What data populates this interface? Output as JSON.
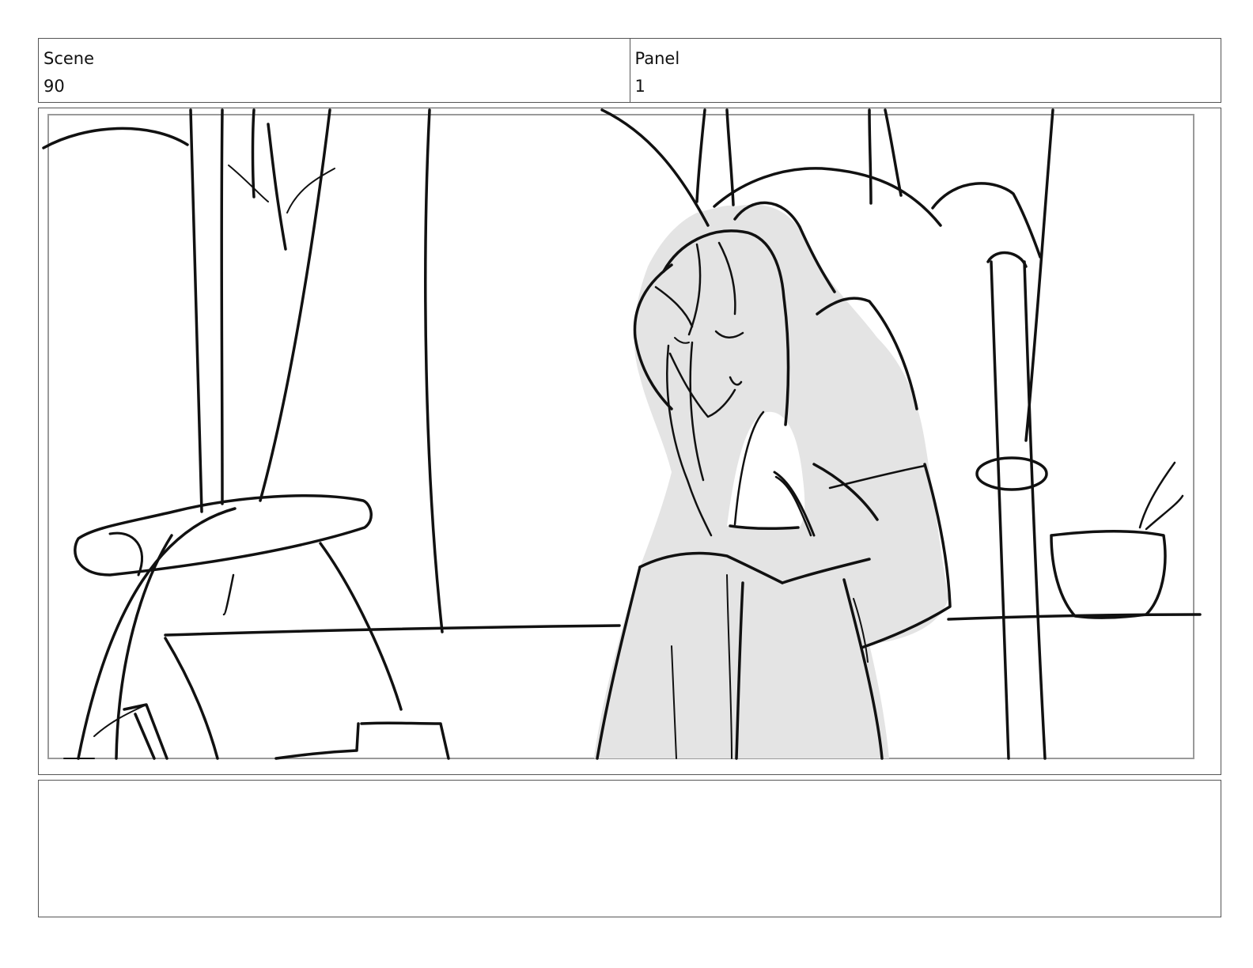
{
  "header": {
    "scene_label": "Scene",
    "scene_value": "90",
    "panel_label": "Panel",
    "panel_value": "1"
  },
  "artwork": {
    "fill_color": "#e4e4e4",
    "line_color": "#111111"
  },
  "notes": {
    "text": ""
  }
}
